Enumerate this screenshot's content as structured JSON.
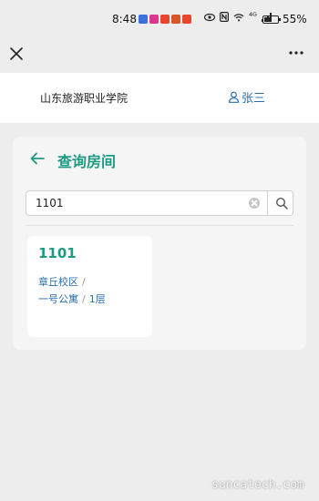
{
  "status_bar": {
    "time": "8:48",
    "network": "⁴ᴳ",
    "battery_percent": "55%",
    "battery_level": 0.55,
    "app_icon_colors": [
      "#3b6fd9",
      "#e0338a",
      "#e8442e",
      "#d9542d",
      "#e8442e"
    ]
  },
  "titlebar": {
    "close_icon": "close-icon",
    "more_icon": "more-dots-icon"
  },
  "header": {
    "school_name": "山东旅游职业学院",
    "user_name": "张三",
    "user_icon": "user-icon",
    "accent_color": "#2a6fb1"
  },
  "page": {
    "title": "查询房间",
    "title_color": "#1e9a82"
  },
  "search": {
    "value": "1101"
  },
  "results": [
    {
      "room": "1101",
      "campus": "章丘校区",
      "building": "一号公寓",
      "floor": "1层"
    }
  ],
  "watermark": "suncatech.com"
}
